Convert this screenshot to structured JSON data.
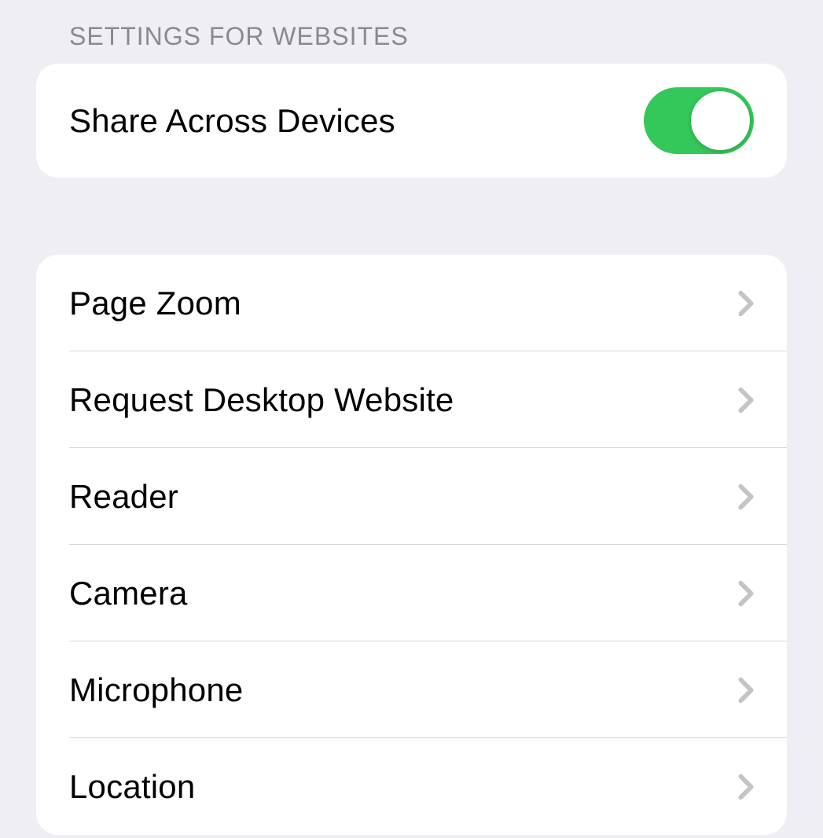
{
  "section": {
    "header": "SETTINGS FOR WEBSITES",
    "toggle_row": {
      "label": "Share Across Devices",
      "enabled": true
    },
    "items": [
      {
        "label": "Page Zoom"
      },
      {
        "label": "Request Desktop Website"
      },
      {
        "label": "Reader"
      },
      {
        "label": "Camera"
      },
      {
        "label": "Microphone"
      },
      {
        "label": "Location"
      }
    ]
  },
  "colors": {
    "background": "#efeef4",
    "card": "#ffffff",
    "header_text": "#8a8a8e",
    "primary_text": "#000000",
    "toggle_on": "#34c759",
    "chevron": "#c4c4c6",
    "separator": "#d6d6d8"
  }
}
